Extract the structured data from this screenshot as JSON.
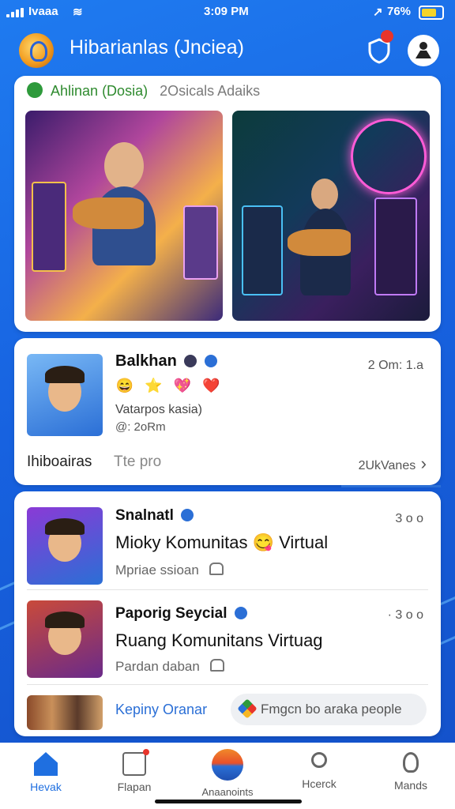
{
  "status_bar": {
    "carrier": "Ivaaa",
    "time": "3:09 PM",
    "battery": "76%"
  },
  "header": {
    "title": "Hibarianlas (Jnciea)"
  },
  "card1": {
    "tag": "Ahlinan (Dosia)",
    "subtitle": "2Osicals Adaiks"
  },
  "card2": {
    "name": "Balkhan",
    "time": "2 Om: 1.a",
    "emojis": [
      "😄",
      "⭐",
      "💖",
      "❤️"
    ],
    "subtitle": "Vatarpos kasia)",
    "meta": "@: 2oRm",
    "footer_left": "Ihiboairas",
    "footer_mid": "Tte pro",
    "footer_right": "2UkVanes",
    "chevron": "›"
  },
  "posts": [
    {
      "name": "Snalnatl",
      "dots": "3 o o",
      "text": "Mioky Komunitas 😋 Virtual",
      "sub": "Mpriae ssioan"
    },
    {
      "name": "Paporig Seycial",
      "dots": "· 3 o o",
      "text": "Ruang Komunitans Virtuag",
      "sub": "Pardan daban"
    }
  ],
  "card3_footer": {
    "link": "Kepiny Oranar",
    "suggest": "Fmgcn bo araka people"
  },
  "nav": [
    {
      "label": "Hevak"
    },
    {
      "label": "Flapan"
    },
    {
      "label": "Anaanoints"
    },
    {
      "label": "Hcerck"
    },
    {
      "label": "Mands"
    }
  ],
  "colors": {
    "accent": "#1f6fe0",
    "header_bg": "#1762e0",
    "alert": "#e8352b"
  }
}
